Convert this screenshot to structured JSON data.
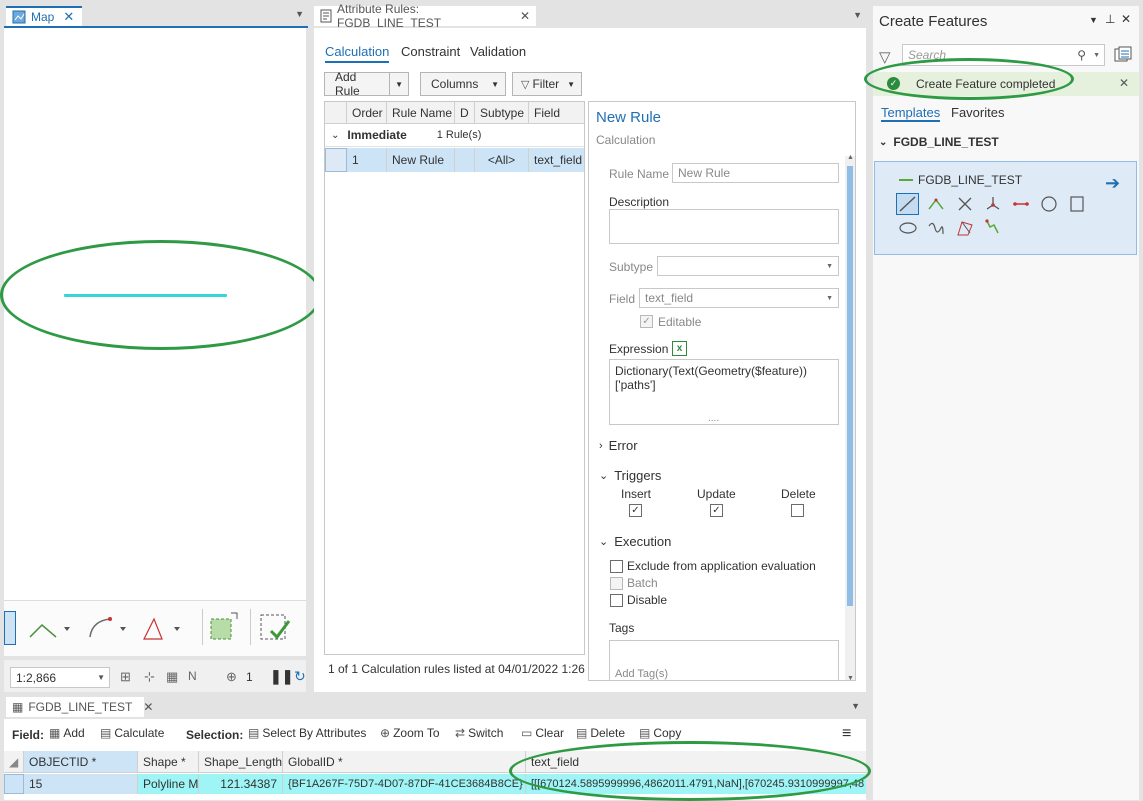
{
  "map": {
    "tab_label": "Map",
    "scale_value": "1:2,866",
    "status_readout": "1"
  },
  "rules": {
    "tab_label": "Attribute Rules: FGDB_LINE_TEST",
    "subtabs": [
      "Calculation",
      "Constraint",
      "Validation"
    ],
    "add_rule_label": "Add Rule",
    "columns_label": "Columns",
    "filter_label": "Filter",
    "headers": [
      "Order",
      "Rule Name",
      "D",
      "Subtype",
      "Field"
    ],
    "group": {
      "name": "Immediate",
      "count": "1 Rule(s)"
    },
    "row": {
      "order": "1",
      "name": "New Rule",
      "subtype": "<All>",
      "field": "text_field"
    },
    "status": "1 of 1 Calculation rules listed at 04/01/2022 1:26:",
    "detail": {
      "title": "New Rule",
      "subtitle": "Calculation",
      "rule_name_label": "Rule Name",
      "rule_name_placeholder": "New Rule",
      "description_label": "Description",
      "subtype_label": "Subtype",
      "field_label": "Field",
      "field_value": "text_field",
      "editable_label": "Editable",
      "expression_label": "Expression",
      "expression_line1": "Dictionary(Text(Geometry($feature))",
      "expression_line2": "['paths']",
      "expression_dots": "....",
      "error_label": "Error",
      "triggers_label": "Triggers",
      "triggers": [
        "Insert",
        "Update",
        "Delete"
      ],
      "triggers_checked": [
        true,
        true,
        false
      ],
      "execution_label": "Execution",
      "execution_options": [
        "Exclude from application evaluation",
        "Batch",
        "Disable"
      ],
      "tags_label": "Tags",
      "tags_placeholder": "Add Tag(s)"
    }
  },
  "create": {
    "title": "Create Features",
    "search_placeholder": "Search",
    "notification": "Create Feature completed",
    "tabs": [
      "Templates",
      "Favorites"
    ],
    "layer": "FGDB_LINE_TEST",
    "template": "FGDB_LINE_TEST"
  },
  "table": {
    "tab_label": "FGDB_LINE_TEST",
    "field_label": "Field:",
    "add_label": "Add",
    "calculate_label": "Calculate",
    "selection_label": "Selection:",
    "select_by_attr_label": "Select By Attributes",
    "zoom_to_label": "Zoom To",
    "switch_label": "Switch",
    "clear_label": "Clear",
    "delete_label": "Delete",
    "copy_label": "Copy",
    "headers": [
      "OBJECTID *",
      "Shape *",
      "Shape_Length",
      "GlobalID *",
      "text_field"
    ],
    "row": [
      "15",
      "Polyline M",
      "121.34387",
      "{BF1A267F-75D7-4D07-87DF-41CE3684B8CE}",
      "[[[670124.5895999996,4862011.4791,NaN],[670245.9310999997,48"
    ]
  },
  "colors": {
    "accent": "#1f6fb4",
    "highlight": "#2e9a44",
    "selection": "#9ff5f5",
    "line": "#35d6d6"
  }
}
